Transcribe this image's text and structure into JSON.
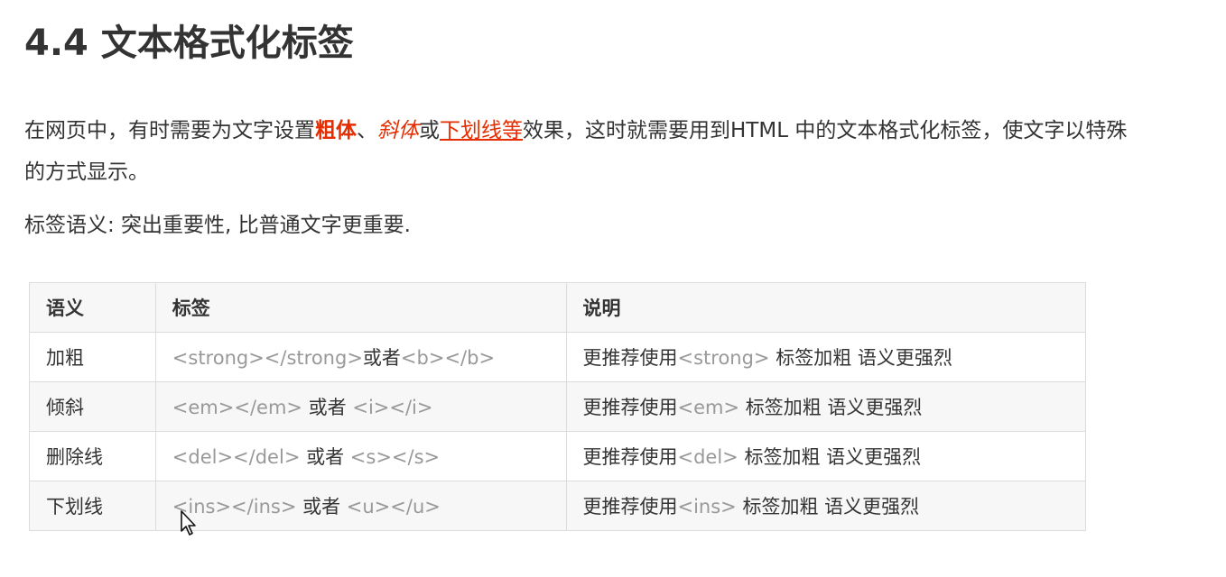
{
  "heading": "4.4 文本格式化标签",
  "intro": {
    "part1": "在网页中，有时需要为文字设置",
    "bold": "粗体",
    "sep1": "、",
    "italic": "斜体",
    "sep2": "或",
    "underline": "下划线等",
    "part2": "效果，这时就需要用到HTML 中的文本格式化标签，使文字以特殊的方式显示。"
  },
  "semantic_note": "标签语义: 突出重要性, 比普通文字更重要.",
  "table": {
    "headers": [
      "语义",
      "标签",
      "说明"
    ],
    "rows": [
      {
        "meaning": "加粗",
        "tag1": "<strong></strong>",
        "or": "或者",
        "tag2": "<b></b>",
        "desc_prefix": "更推荐使用",
        "desc_tag": "<strong>",
        "desc_suffix": " 标签加粗 语义更强烈"
      },
      {
        "meaning": "倾斜",
        "tag1": "<em></em>",
        "or": " 或者 ",
        "tag2": "<i></i>",
        "desc_prefix": "更推荐使用",
        "desc_tag": "<em>",
        "desc_suffix": " 标签加粗 语义更强烈"
      },
      {
        "meaning": "删除线",
        "tag1": "<del></del>",
        "or": " 或者 ",
        "tag2": "<s></s>",
        "desc_prefix": "更推荐使用",
        "desc_tag": "<del>",
        "desc_suffix": " 标签加粗 语义更强烈"
      },
      {
        "meaning": "下划线",
        "tag1": "<ins></ins>",
        "or": " 或者 ",
        "tag2": "<u></u>",
        "desc_prefix": "更推荐使用",
        "desc_tag": "<ins>",
        "desc_suffix": " 标签加粗 语义更强烈"
      }
    ]
  },
  "colors": {
    "emphasis": "#e52d00",
    "tag_gray": "#999999",
    "text": "#333333",
    "border": "#dcdcdc",
    "row_alt": "#f7f7f7"
  },
  "icons": {
    "cursor": "mouse-pointer-icon"
  }
}
